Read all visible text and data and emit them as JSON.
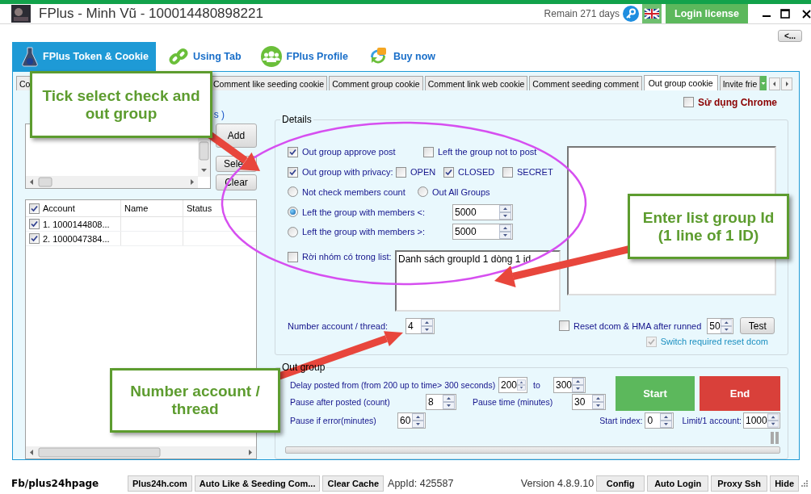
{
  "window": {
    "title": "FPlus - Minh Vũ - 100014480898221",
    "remaining": "Remain 271 days",
    "login_button": "Login license",
    "back_button": "<..."
  },
  "main_tabs": [
    {
      "label": "FPlus Token & Cookie",
      "selected": true
    },
    {
      "label": "Using Tab",
      "selected": false
    },
    {
      "label": "FPlus Profile",
      "selected": false
    },
    {
      "label": "Buy now",
      "selected": false
    }
  ],
  "sub_tabs": [
    {
      "label": "Co",
      "selected": false
    },
    {
      "label": "Comment like seeding cookie",
      "selected": false
    },
    {
      "label": "Comment group cookie",
      "selected": false
    },
    {
      "label": "Comment link web cookie",
      "selected": false
    },
    {
      "label": "Comment seeding comment",
      "selected": false
    },
    {
      "label": "Out group cookie",
      "selected": true
    },
    {
      "label": "Invite frie",
      "selected": false
    }
  ],
  "left_panel": {
    "caption_tail": "s )",
    "buttons": [
      "Add",
      "Sele",
      "Clear"
    ],
    "accounts": {
      "all_checked": true,
      "columns": [
        "Account",
        "Name",
        "Status"
      ],
      "rows": [
        {
          "account": "1. 1000144808...",
          "checked": true
        },
        {
          "account": "2. 1000047384...",
          "checked": true
        }
      ]
    }
  },
  "use_chrome": {
    "label": "Sử dụng Chrome",
    "checked": false
  },
  "details": {
    "title": "Details",
    "rows": [
      [
        {
          "kind": "checkbox",
          "label": "Out group approve post",
          "checked": true
        },
        {
          "kind": "checkbox",
          "label": "Left the group not to post",
          "checked": false
        }
      ],
      [
        {
          "kind": "checkbox",
          "label": "Out group with privacy:",
          "checked": true
        },
        {
          "kind": "checkbox",
          "label": "OPEN",
          "checked": false
        },
        {
          "kind": "checkbox",
          "label": "CLOSED",
          "checked": true
        },
        {
          "kind": "checkbox",
          "label": "SECRET",
          "checked": false
        }
      ],
      [
        {
          "kind": "radio",
          "label": "Not check members count",
          "selected": false
        },
        {
          "kind": "radio",
          "label": "Out All Groups",
          "selected": false
        }
      ],
      [
        {
          "kind": "radio",
          "label": "Left the group with members <:",
          "selected": true
        },
        {
          "kind": "spinner",
          "value": "5000"
        }
      ],
      [
        {
          "kind": "radio",
          "label": "Left the group with members >:",
          "selected": false
        },
        {
          "kind": "spinner",
          "value": "5000"
        }
      ]
    ],
    "list_filter": {
      "label": "Rời nhóm có trong list:",
      "checked": false,
      "value": "Danh sách groupId 1 dòng 1 id"
    },
    "threads": {
      "label": "Number account / thread:",
      "value": "4"
    },
    "reset_dcom": {
      "label": "Reset dcom & HMA after runned",
      "checked": false,
      "value": "50",
      "button": "Test"
    },
    "switch_reset": {
      "label": "Switch required reset dcom",
      "checked": true,
      "disabled": true
    }
  },
  "out_group": {
    "title": "Out group",
    "delay_label": "Delay posted from (from 200 up to time> 300 seconds)",
    "delay_from": "200",
    "to_label": "to",
    "delay_to": "300",
    "pause_after_label": "Pause after posted (count)",
    "pause_after": "8",
    "pause_time_label": "Pause time (minutes)",
    "pause_time": "30",
    "pause_error_label": "Pause if error(minutes)",
    "pause_error": "60",
    "start_index_label": "Start index:",
    "start_index": "0",
    "limit_label": "Limit/1 account:",
    "limit": "1000",
    "start_button": "Start",
    "end_button": "End",
    "progress": {
      "level": 0
    }
  },
  "status_bar": {
    "page": "Fb/plus24hpage",
    "buttons_left": [
      "Plus24h.com",
      "Auto Like & Seeding Com...",
      "Clear Cache"
    ],
    "app_id": "AppId: 425587",
    "version": "Version 4.8.9.10",
    "buttons_right": [
      "Config",
      "Auto Login",
      "Proxy Ssh",
      "Hide"
    ]
  },
  "annotations": [
    {
      "lines": [
        "Tick select check and",
        "out group"
      ]
    },
    {
      "lines": [
        "Enter list group Id",
        "(1 line of 1 ID)"
      ]
    },
    {
      "lines": [
        "Number account /",
        "thread"
      ]
    }
  ]
}
